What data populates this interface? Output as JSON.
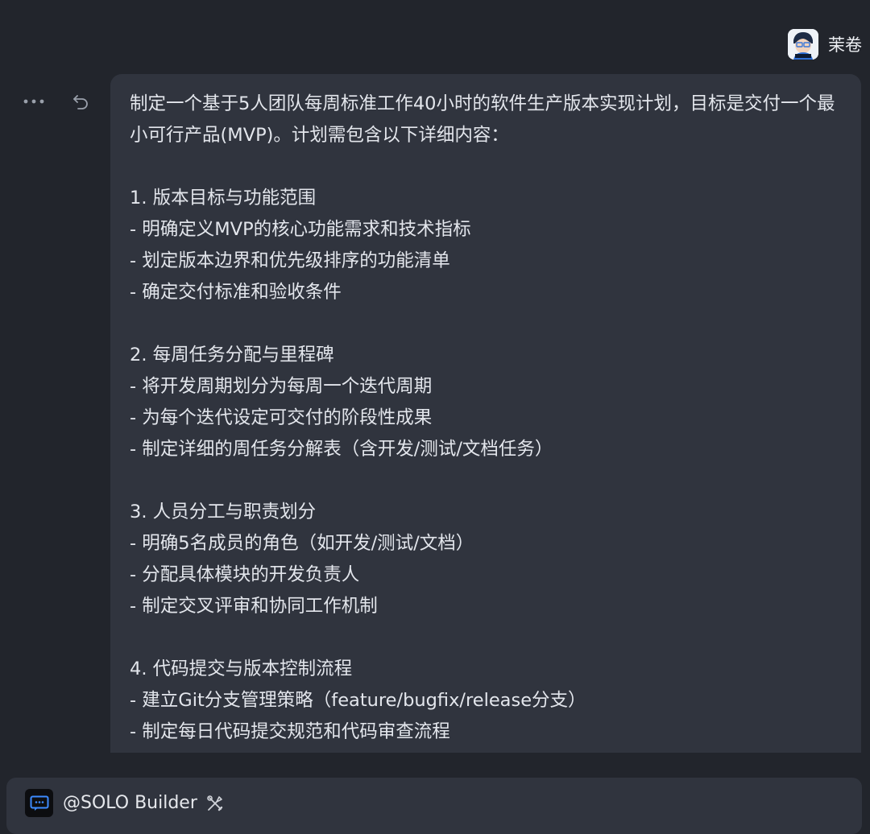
{
  "header": {
    "username": "茉卷",
    "avatar_icon": "avatar-icon"
  },
  "message": {
    "text": "制定一个基于5人团队每周标准工作40小时的软件生产版本实现计划，目标是交付一个最小可行产品(MVP)。计划需包含以下详细内容：\n\n1. 版本目标与功能范围\n- 明确定义MVP的核心功能需求和技术指标\n- 划定版本边界和优先级排序的功能清单\n- 确定交付标准和验收条件\n\n2. 每周任务分配与里程碑\n- 将开发周期划分为每周一个迭代周期\n- 为每个迭代设定可交付的阶段性成果\n- 制定详细的周任务分解表（含开发/测试/文档任务）\n\n3. 人员分工与职责划分\n- 明确5名成员的角色（如开发/测试/文档）\n- 分配具体模块的开发负责人\n- 制定交叉评审和协同工作机制\n\n4. 代码提交与版本控制流程\n- 建立Git分支管理策略（feature/bugfix/release分支）\n- 制定每日代码提交规范和代码审查流程\n- 设置持续集成自动构建流程"
  },
  "actions": {
    "more_icon": "more-icon",
    "undo_icon": "undo-icon"
  },
  "composer": {
    "agent_name": "@SOLO Builder",
    "agent_icon": "chat-icon",
    "tools_icon": "tools-icon"
  }
}
